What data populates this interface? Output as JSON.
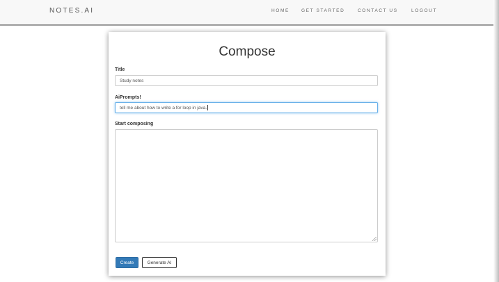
{
  "nav": {
    "brand": "NOTES.AI",
    "links": [
      "HOME",
      "GET STARTED",
      "CONTACT US",
      "LOGOUT"
    ]
  },
  "compose": {
    "title": "Compose",
    "title_label": "Title",
    "title_value": "Study notes",
    "prompt_label": "AiPrompts!",
    "prompt_value": "tell me about how to write a for loop in java.",
    "body_label": "Start composing",
    "body_value": "",
    "create_label": "Create",
    "generate_label": "Generate AI"
  },
  "colors": {
    "primary": "#337ab7",
    "focus": "#66afe9",
    "navbar_bg": "#f8f8f8"
  }
}
